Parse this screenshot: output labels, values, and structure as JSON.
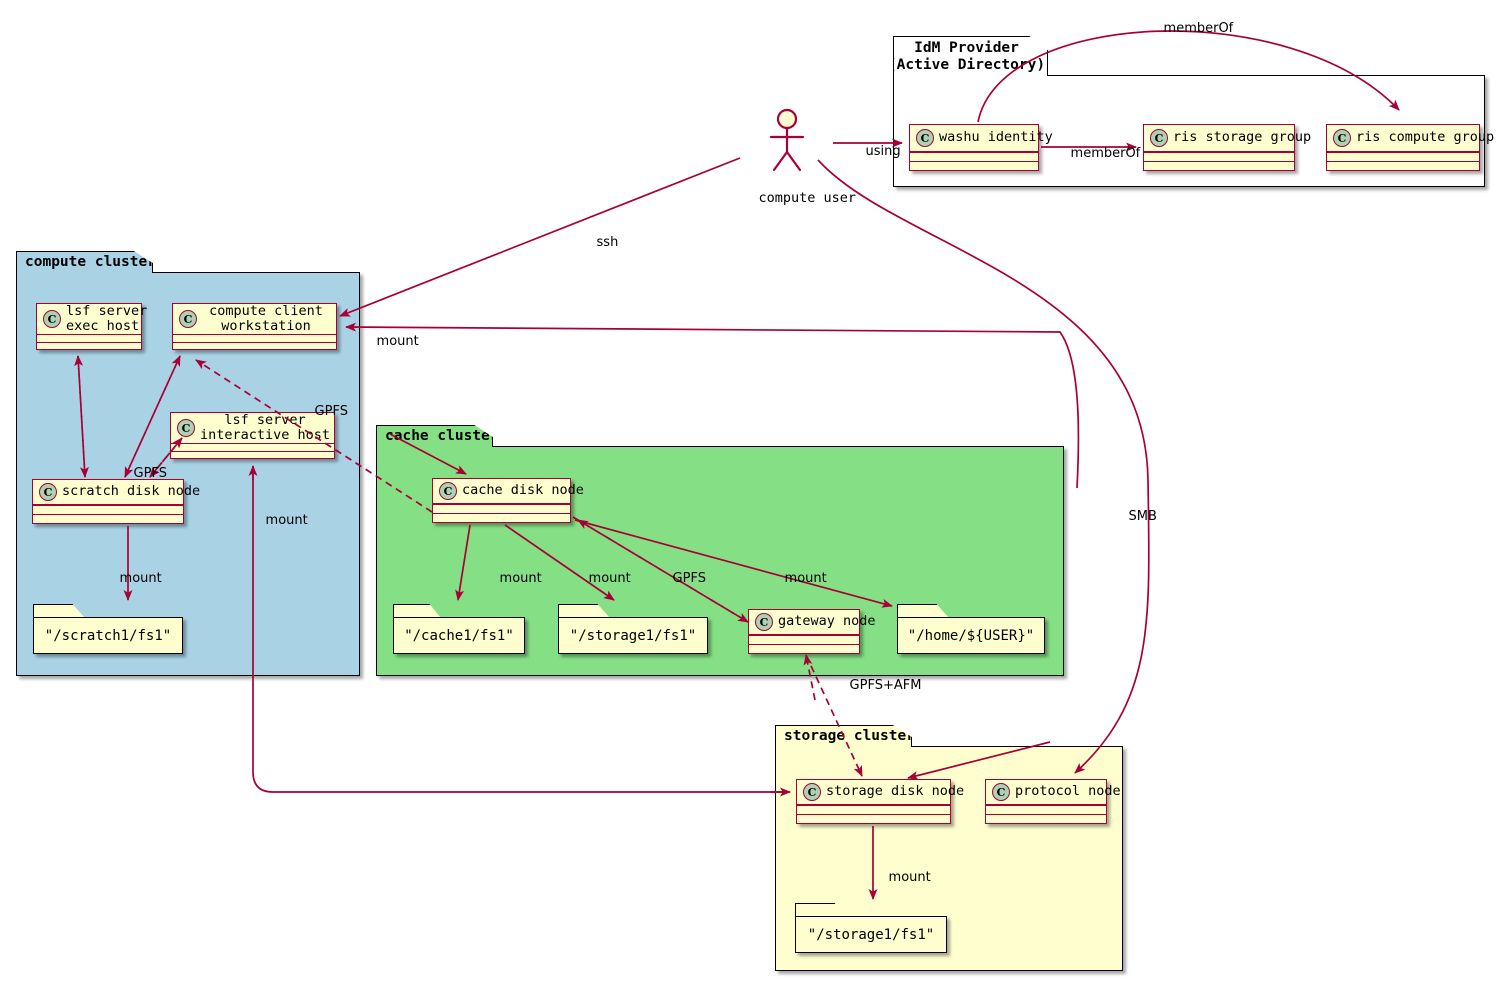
{
  "diagram": {
    "actor": {
      "name": "compute user",
      "icon": "actor-stick-figure"
    },
    "packages": [
      {
        "id": "idm",
        "label": "IdM Provider\n(Active Directory)",
        "color": "#FFFFFF"
      },
      {
        "id": "compute",
        "label": "compute cluster",
        "color": "#A9D3E5"
      },
      {
        "id": "cache",
        "label": "cache cluster",
        "color": "#85E085"
      },
      {
        "id": "storage",
        "label": "storage cluster",
        "color": "#FEFECE"
      }
    ],
    "classes": [
      {
        "id": "washu",
        "label": "washu identity",
        "pkg": "idm",
        "stereotype": "C"
      },
      {
        "id": "risstorage",
        "label": "ris storage group",
        "pkg": "idm",
        "stereotype": "C"
      },
      {
        "id": "riscompute",
        "label": "ris compute group",
        "pkg": "idm",
        "stereotype": "C"
      },
      {
        "id": "lsfexec",
        "label": "lsf server\nexec host",
        "pkg": "compute",
        "stereotype": "C"
      },
      {
        "id": "client",
        "label": "compute client\nworkstation",
        "pkg": "compute",
        "stereotype": "C"
      },
      {
        "id": "lsfint",
        "label": "lsf server\ninteractive host",
        "pkg": "compute",
        "stereotype": "C"
      },
      {
        "id": "scratchnode",
        "label": "scratch disk node",
        "pkg": "compute",
        "stereotype": "C"
      },
      {
        "id": "cachenode",
        "label": "cache disk node",
        "pkg": "cache",
        "stereotype": "C"
      },
      {
        "id": "gateway",
        "label": "gateway node",
        "pkg": "cache",
        "stereotype": "C"
      },
      {
        "id": "storagenode",
        "label": "storage disk node",
        "pkg": "storage",
        "stereotype": "C"
      },
      {
        "id": "protocol",
        "label": "protocol node",
        "pkg": "storage",
        "stereotype": "C"
      }
    ],
    "folders": [
      {
        "id": "scratchfs",
        "label": "\"/scratch1/fs1\"",
        "pkg": "compute"
      },
      {
        "id": "cachefs",
        "label": "\"/cache1/fs1\"",
        "pkg": "cache"
      },
      {
        "id": "cachestore",
        "label": "\"/storage1/fs1\"",
        "pkg": "cache"
      },
      {
        "id": "homefs",
        "label": "\"/home/${USER}\"",
        "pkg": "cache"
      },
      {
        "id": "storagefs",
        "label": "\"/storage1/fs1\"",
        "pkg": "storage"
      }
    ],
    "edges": [
      {
        "id": "e-using",
        "label": "using",
        "from": "compute user",
        "to": "washu identity",
        "style": "solid"
      },
      {
        "id": "e-memberof-1",
        "label": "memberOf",
        "from": "washu identity",
        "to": "ris storage group",
        "style": "solid"
      },
      {
        "id": "e-memberof-2",
        "label": "memberOf",
        "from": "washu identity",
        "to": "ris compute group",
        "style": "solid"
      },
      {
        "id": "e-ssh",
        "label": "ssh",
        "from": "compute user",
        "to": "compute client workstation",
        "style": "solid"
      },
      {
        "id": "e-smb",
        "label": "SMB",
        "from": "compute user",
        "to": "protocol node",
        "style": "solid"
      },
      {
        "id": "e-gpfs-exec",
        "label": "GPFS",
        "from": "scratch disk node",
        "to": "lsf server exec host",
        "style": "dashed"
      },
      {
        "id": "e-gpfs-client",
        "label": "GPFS",
        "from": "scratch disk node",
        "to": "compute client workstation",
        "style": "dashed"
      },
      {
        "id": "e-gpfs-int",
        "label": "GPFS",
        "from": "scratch disk node",
        "to": "lsf server interactive host",
        "style": "dashed"
      },
      {
        "id": "e-gpfs-cache",
        "label": "GPFS",
        "from": "cache disk node",
        "to": "compute client workstation",
        "style": "dashed"
      },
      {
        "id": "e-mount-scratch",
        "label": "mount",
        "from": "scratch disk node",
        "to": "\"/scratch1/fs1\"",
        "style": "solid"
      },
      {
        "id": "e-mount-client",
        "label": "mount",
        "from": "cache disk node",
        "to": "compute client workstation",
        "style": "solid"
      },
      {
        "id": "e-mount-int",
        "label": "mount",
        "from": "storage disk node",
        "to": "lsf server interactive host",
        "style": "solid"
      },
      {
        "id": "e-mount-cache",
        "label": "mount",
        "from": "cache disk node",
        "to": "\"/cache1/fs1\"",
        "style": "solid"
      },
      {
        "id": "e-mount-cstore",
        "label": "mount",
        "from": "cache disk node",
        "to": "\"/storage1/fs1\"",
        "style": "solid"
      },
      {
        "id": "e-mount-home",
        "label": "mount",
        "from": "cache disk node",
        "to": "\"/home/${USER}\"",
        "style": "solid"
      },
      {
        "id": "e-gpfs-gw",
        "label": "GPFS",
        "from": "gateway node",
        "to": "cache disk node",
        "style": "dashed"
      },
      {
        "id": "e-gpfsafm",
        "label": "GPFS+AFM",
        "from": "storage disk node",
        "to": "gateway node",
        "style": "dashed"
      },
      {
        "id": "e-mount-sfs",
        "label": "mount",
        "from": "storage disk node",
        "to": "\"/storage1/fs1\"",
        "style": "solid"
      },
      {
        "id": "e-cachearrow",
        "label": "",
        "from": "compute cluster",
        "to": "cache disk node",
        "style": "solid"
      },
      {
        "id": "e-storagearrow",
        "label": "",
        "from": "cache cluster",
        "to": "storage disk node",
        "style": "solid"
      }
    ],
    "colors": {
      "line": "#A80036",
      "class_fill": "#FEFECE",
      "class_border": "#A80036",
      "icon_fill": "#ADD1B2",
      "compute_pkg": "#A9D3E5",
      "cache_pkg": "#85E085",
      "storage_pkg": "#FEFECE",
      "idm_pkg": "#FFFFFF",
      "text": "#000000"
    }
  }
}
